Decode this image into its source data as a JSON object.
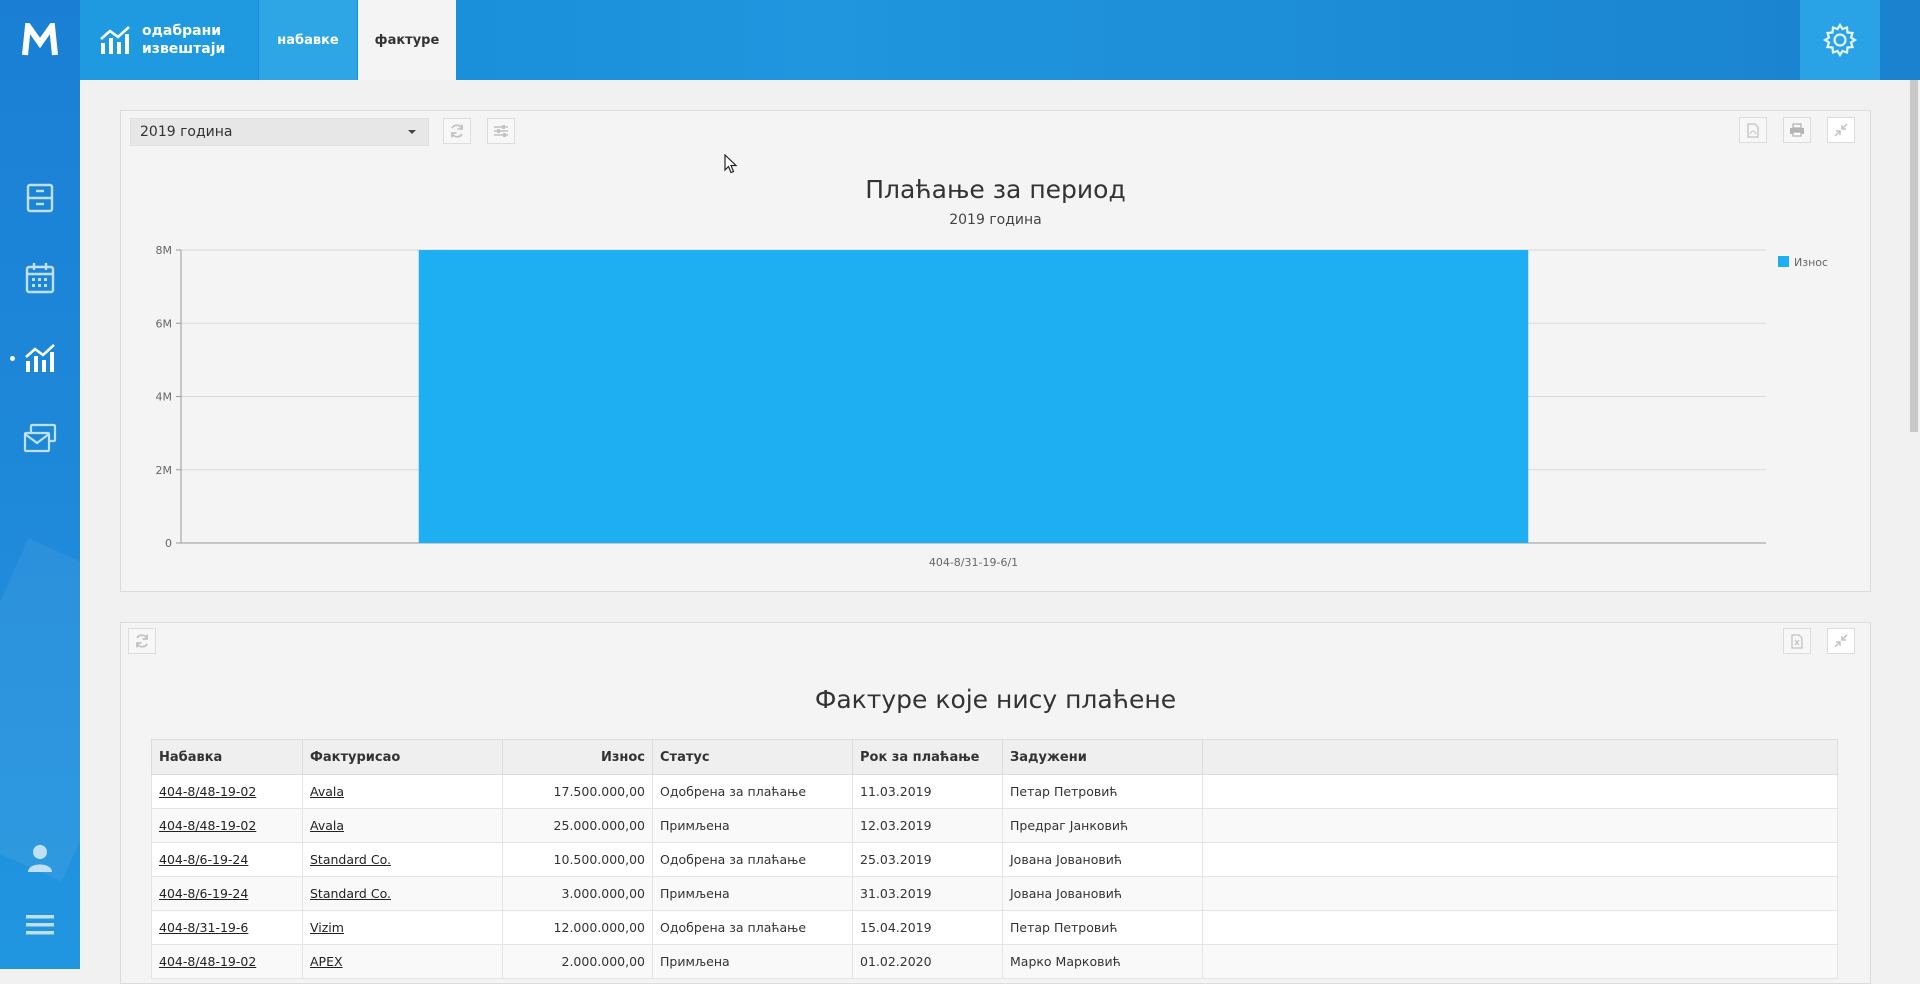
{
  "app": {
    "logo_letter": "M",
    "brand_color": "#1a82d6"
  },
  "sidebar": {
    "items": [
      {
        "icon": "cabinet-icon",
        "active": false
      },
      {
        "icon": "calendar-icon",
        "active": false
      },
      {
        "icon": "reports-chart-icon",
        "active": true
      },
      {
        "icon": "mail-stack-icon",
        "active": false
      }
    ],
    "bottom": [
      {
        "icon": "user-icon"
      },
      {
        "icon": "menu-icon"
      }
    ]
  },
  "header": {
    "reports_title": "одабрани\nизвештаји",
    "tabs": [
      {
        "label": "набавке",
        "active": false
      },
      {
        "label": "фактуре",
        "active": true
      }
    ]
  },
  "chart_panel": {
    "year_selected": "2019 година",
    "toolbar_icons": [
      "refresh-icon",
      "filter-sliders-icon",
      "pdf-icon",
      "print-icon",
      "collapse-icon"
    ]
  },
  "chart_data": {
    "type": "bar",
    "title": "Плаћање за период",
    "subtitle": "2019 година",
    "categories": [
      "404-8/31-19-6/1"
    ],
    "series": [
      {
        "name": "Износ",
        "values": [
          8000000
        ],
        "color": "#1eaef2"
      }
    ],
    "ylim": [
      0,
      8000000
    ],
    "yticks": [
      "0",
      "2M",
      "4M",
      "6M",
      "8M"
    ],
    "grid": true,
    "legend": "top-right"
  },
  "table_panel": {
    "title": "Фактуре које нису плаћене",
    "toolbar_icons": [
      "refresh-icon",
      "excel-export-icon",
      "collapse-icon"
    ],
    "columns": [
      "Набавка",
      "Фактурисао",
      "Износ",
      "Статус",
      "Рок за плаћање",
      "Задужени"
    ],
    "rows": [
      [
        "404-8/48-19-02",
        "Avala",
        "17.500.000,00",
        "Одобрена за плаћање",
        "11.03.2019",
        "Петар Петровић"
      ],
      [
        "404-8/48-19-02",
        "Avala",
        "25.000.000,00",
        "Примљена",
        "12.03.2019",
        "Предраг Јанковић"
      ],
      [
        "404-8/6-19-24",
        "Standard Co.",
        "10.500.000,00",
        "Одобрена за плаћање",
        "25.03.2019",
        "Јована Јовановић"
      ],
      [
        "404-8/6-19-24",
        "Standard Co.",
        "3.000.000,00",
        "Примљена",
        "31.03.2019",
        "Јована Јовановић"
      ],
      [
        "404-8/31-19-6",
        "Vizim",
        "12.000.000,00",
        "Одобрена за плаћање",
        "15.04.2019",
        "Петар Петровић"
      ],
      [
        "404-8/48-19-02",
        "APEX",
        "2.000.000,00",
        "Примљена",
        "01.02.2020",
        "Марко Марковић"
      ]
    ]
  }
}
